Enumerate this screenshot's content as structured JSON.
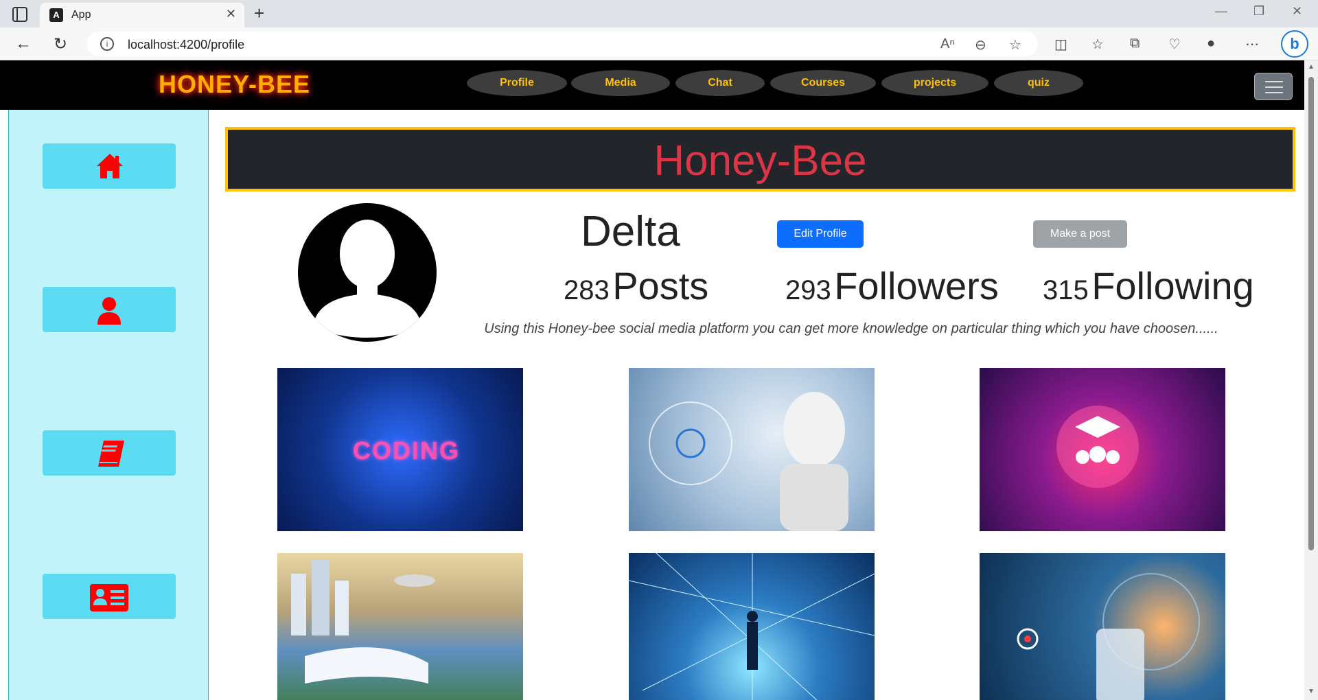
{
  "browser": {
    "tab_title": "App",
    "tab_favicon_letter": "A",
    "url": "localhost:4200/profile",
    "icons": [
      "sidebar-icon",
      "back-icon",
      "refresh-icon",
      "info-icon",
      "read-aloud-icon",
      "zoom-out-icon",
      "favorite-star-icon",
      "split-screen-icon",
      "favorites-icon",
      "collections-icon",
      "browser-essentials-icon",
      "profile-icon",
      "more-icon",
      "bing-icon"
    ]
  },
  "navbar": {
    "brand": "HONEY-BEE",
    "items": [
      {
        "label": "Profile"
      },
      {
        "label": "Media"
      },
      {
        "label": "Chat"
      },
      {
        "label": "Courses"
      },
      {
        "label": "projects"
      },
      {
        "label": "quiz"
      }
    ]
  },
  "sidebar": {
    "buttons": [
      {
        "icon": "home-icon"
      },
      {
        "icon": "user-icon"
      },
      {
        "icon": "book-icon"
      },
      {
        "icon": "contact-card-icon"
      }
    ],
    "icon_color": "#ff0000"
  },
  "profile": {
    "banner_title": "Honey-Bee",
    "username": "Delta",
    "edit_button": "Edit Profile",
    "post_button": "Make a post",
    "stats": {
      "posts_count": "283",
      "posts_label": "Posts",
      "followers_count": "293",
      "followers_label": "Followers",
      "following_count": "315",
      "following_label": "Following"
    },
    "bio": "Using this Honey-bee social media platform you can get more knowledge on particular thing which you have choosen......",
    "tile_1_word": "CODING"
  },
  "colors": {
    "brand": "#ffb000",
    "banner_border": "#ffc107",
    "banner_title": "#dc3545",
    "primary_button": "#0d6efd",
    "sidebar_bg": "#c3f3fb",
    "sidebar_button": "#5bdcf2"
  }
}
